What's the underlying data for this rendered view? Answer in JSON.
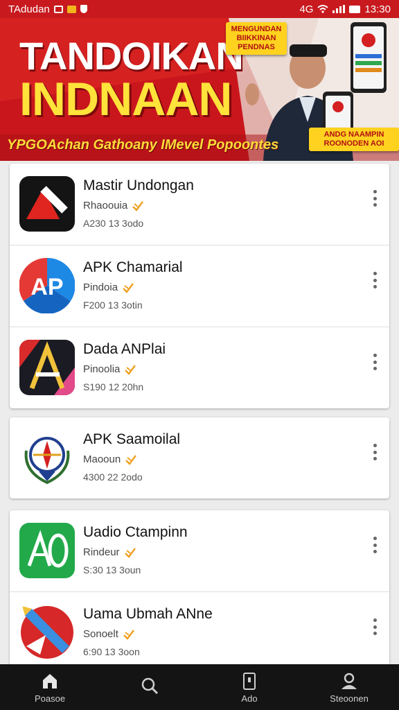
{
  "status_bar": {
    "app_label": "TAdudan",
    "network": "4G",
    "time": "13:30"
  },
  "banner": {
    "title_line1": "TANDOIKAN",
    "title_line2": "INDNAAN",
    "tagline": "YPGOAchan Gathoany IMevel Popoontes",
    "badge_top": "MENGUNDAN BIIKKINAN PENDNAS",
    "badge_bottom": "ANDG NAAMPIN ROONODEN AOI"
  },
  "apps": [
    {
      "name": "Mastir Undongan",
      "developer": "Rhaoouia",
      "meta": "A230 13 3odo",
      "icon": "app-red-arrow-icon"
    },
    {
      "name": "APK Chamarial",
      "developer": "Pindoia",
      "meta": "F200 13 3otin",
      "icon": "ap-logo-icon"
    },
    {
      "name": "Dada ANPlai",
      "developer": "Pinoolia",
      "meta": "S190 12 20hn",
      "icon": "letter-a-icon"
    },
    {
      "name": "APK Saamoilal",
      "developer": "Maooun",
      "meta": "4300 22 2odo",
      "icon": "emblem-icon"
    },
    {
      "name": "Uadio Ctampinn",
      "developer": "Rindeur",
      "meta": "S:30 13 3oun",
      "icon": "green-ao-icon"
    },
    {
      "name": "Uama Ubmah ANne",
      "developer": "Sonoelt",
      "meta": "6:90 13 3oon",
      "icon": "red-pen-icon"
    }
  ],
  "nav": [
    {
      "label": "Poasoe",
      "icon": "home-icon"
    },
    {
      "label": "",
      "icon": "search-icon"
    },
    {
      "label": "Ado",
      "icon": "phone-icon"
    },
    {
      "label": "Steoonen",
      "icon": "profile-icon"
    }
  ],
  "colors": {
    "brand_red": "#c81a1e",
    "banner_yellow": "#ffe23a",
    "verified_orange": "#f0a020"
  }
}
